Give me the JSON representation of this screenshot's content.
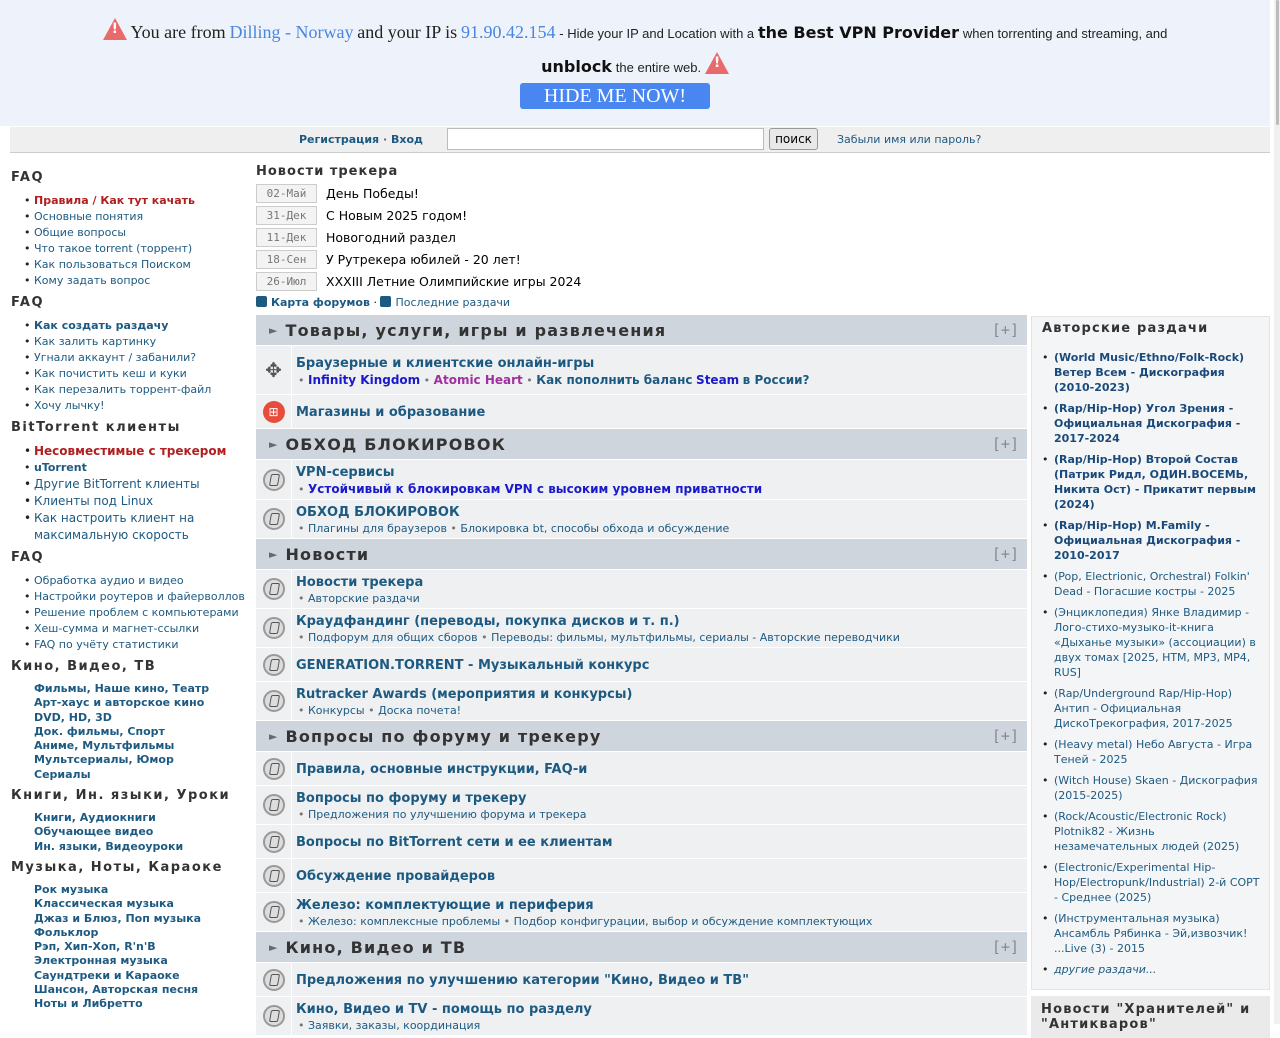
{
  "banner": {
    "p1": "You are from",
    "location": "Dilling - Norway",
    "p2": "and your IP is",
    "ip": "91.90.42.154",
    "p3": "- Hide your IP and Location with a",
    "bold1": "the Best VPN Provider",
    "p4": "when torrenting and streaming, and",
    "bold2": "unblock",
    "p5": "the entire web.",
    "button": "HIDE ME NOW!"
  },
  "nav": {
    "register": "Регистрация",
    "sep": "·",
    "login": "Вход",
    "search_value": "",
    "search_button": "поиск",
    "forgot": "Забыли имя или пароль?"
  },
  "left": [
    {
      "title": "FAQ",
      "items": [
        {
          "label": "Правила / Как тут качать",
          "style": "red"
        },
        {
          "label": "Основные понятия"
        },
        {
          "label": "Общие вопросы"
        },
        {
          "label": "Что такое torrent (торрент)"
        },
        {
          "label": "Как пользоваться Поиском"
        },
        {
          "label": "Кому задать вопрос"
        }
      ]
    },
    {
      "title": "FAQ",
      "items": [
        {
          "label": "Как создать раздачу",
          "style": "b"
        },
        {
          "label": "Как залить картинку"
        },
        {
          "label": "Угнали аккаунт / забанили?"
        },
        {
          "label": "Как почистить кеш и куки"
        },
        {
          "label": "Как перезалить торрент-файл"
        },
        {
          "label": "Хочу лычку!"
        }
      ]
    },
    {
      "title": "BitTorrent клиенты",
      "items": [
        {
          "label": "Несовместимые с трекером",
          "style": "red big"
        },
        {
          "label": "uTorrent",
          "style": "b"
        },
        {
          "label": "Другие BitTorrent клиенты",
          "style": "big"
        },
        {
          "label": "Клиенты под Linux",
          "style": "big"
        },
        {
          "label": "Как настроить клиент на максимальную скорость",
          "style": "big"
        }
      ]
    },
    {
      "title": "FAQ",
      "items": [
        {
          "label": "Обработка аудио и видео"
        },
        {
          "label": "Настройки роутеров и файерволлов"
        },
        {
          "label": "Решение проблем с компьютерами"
        },
        {
          "label": "Хеш-сумма и магнет-ссылки"
        },
        {
          "label": "FAQ по учёту статистики"
        }
      ]
    },
    {
      "title": "Кино, Видео, ТВ",
      "plain": true,
      "items": [
        {
          "label": "Фильмы, Наше кино, Театр"
        },
        {
          "label": "Арт-хаус и авторское кино"
        },
        {
          "label": "DVD, HD, 3D"
        },
        {
          "label": "Док. фильмы, Спорт"
        },
        {
          "label": "Аниме, Мультфильмы"
        },
        {
          "label": "Мультсериалы, Юмор"
        },
        {
          "label": "Сериалы"
        }
      ]
    },
    {
      "title": "Книги, Ин. языки, Уроки",
      "plain": true,
      "items": [
        {
          "label": "Книги, Аудиокниги"
        },
        {
          "label": "Обучающее видео"
        },
        {
          "label": "Ин. языки, Видеоуроки"
        }
      ]
    },
    {
      "title": "Музыка, Ноты, Караоке",
      "plain": true,
      "items": [
        {
          "label": "Рок музыка"
        },
        {
          "label": "Классическая музыка"
        },
        {
          "label": "Джаз и Блюз, Поп музыка"
        },
        {
          "label": "Фольклор"
        },
        {
          "label": "Рэп, Хип-Хоп, R'n'B"
        },
        {
          "label": "Электронная музыка"
        },
        {
          "label": "Саундтреки и Караоке"
        },
        {
          "label": "Шансон, Авторская песня"
        },
        {
          "label": "Ноты и Либретто"
        }
      ]
    }
  ],
  "news": {
    "title": "Новости трекера",
    "items": [
      {
        "date": "02-Май",
        "text": "День Победы!"
      },
      {
        "date": "31-Дек",
        "text": "С Новым 2025 годом!"
      },
      {
        "date": "11-Дек",
        "text": "Новогодний раздел"
      },
      {
        "date": "18-Сен",
        "text": "У Рутрекера юбилей - 20 лет!"
      },
      {
        "date": "26-Июл",
        "text": "XXXIII Летние Олимпийские игры 2024"
      }
    ]
  },
  "links": {
    "map": "Карта форумов",
    "dot": "·",
    "latest": "Последние раздачи"
  },
  "colors": {
    "sub_blue": "#1a1acc",
    "sub_purple": "#a030a0"
  },
  "sections": [
    {
      "title": "Товары, услуги, игры и развлечения",
      "toggle": "[+]",
      "forums": [
        {
          "icon": "gamepad",
          "title": "Браузерные и клиентские онлайн-игры",
          "subs": [
            {
              "t": "Infinity Kingdom",
              "c": "#1a1acc"
            },
            {
              "t": "Atomic Heart",
              "c": "#a030a0"
            },
            {
              "t": "Как пополнить баланс",
              "c": "#1d5a82",
              "extra": "Steam",
              "extra2": "в России?"
            }
          ]
        },
        {
          "icon": "cart",
          "title": "Магазины и образование",
          "subs": []
        }
      ]
    },
    {
      "title": "ОБХОД БЛОКИРОВОК",
      "toggle": "[+]",
      "forums": [
        {
          "title": "VPN-сервисы",
          "subs": [
            {
              "t": "Устойчивый к блокировкам VPN с высоким уровнем приватности",
              "c": "#1a1acc",
              "bold": true
            }
          ]
        },
        {
          "title": "ОБХОД БЛОКИРОВОК",
          "subs": [
            {
              "t": "Плагины для браузеров"
            },
            {
              "t": "Блокировка bt, способы обхода и обсуждение"
            }
          ]
        }
      ]
    },
    {
      "title": "Новости",
      "toggle": "[+]",
      "forums": [
        {
          "title": "Новости трекера",
          "subs": [
            {
              "t": "Авторские раздачи"
            }
          ]
        },
        {
          "title": "Краудфандинг (переводы, покупка дисков и т. п.)",
          "subs": [
            {
              "t": "Подфорум для общих сборов"
            },
            {
              "t": "Переводы: фильмы, мультфильмы, сериалы - Авторские переводчики"
            }
          ]
        },
        {
          "title": "GENERATION.TORRENT - Музыкальный конкурс",
          "subs": []
        },
        {
          "title": "Rutracker Awards (мероприятия и конкурсы)",
          "subs": [
            {
              "t": "Конкурсы"
            },
            {
              "t": "Доска почета!"
            }
          ]
        }
      ]
    },
    {
      "title": "Вопросы по форуму и трекеру",
      "toggle": "[+]",
      "forums": [
        {
          "title": "Правила, основные инструкции, FAQ-и",
          "subs": []
        },
        {
          "title": "Вопросы по форуму и трекеру",
          "subs": [
            {
              "t": "Предложения по улучшению форума и трекера"
            }
          ]
        },
        {
          "title": "Вопросы по BitTorrent сети и ее клиентам",
          "subs": []
        },
        {
          "title": "Обсуждение провайдеров",
          "subs": []
        },
        {
          "title": "Железо: комплектующие и периферия",
          "subs": [
            {
              "t": "Железо: комплексные проблемы"
            },
            {
              "t": "Подбор конфигурации, выбор и обсуждение комплектующих"
            }
          ]
        }
      ]
    },
    {
      "title": "Кино, Видео и ТВ",
      "toggle": "[+]",
      "forums": [
        {
          "title": "Предложения по улучшению категории \"Кино, Видео и ТВ\"",
          "subs": []
        },
        {
          "title": "Кино, Видео и TV - помощь по разделу",
          "subs": [
            {
              "t": "Заявки, заказы, координация"
            }
          ]
        }
      ]
    }
  ],
  "right": {
    "title": "Авторские раздачи",
    "items": [
      {
        "t": "(World Music/Ethno/Folk-Rock) Ветер Всем - Дискография (2010-2023)",
        "b": true
      },
      {
        "t": "(Rap/Hip-Hop) Угол Зрения - Официальная Дискография - 2017-2024",
        "b": true
      },
      {
        "t": "(Rap/Hip-Hop) Второй Состав (Патрик Ридл, ОДИН.ВОСЕМЬ, Никита Ост) - Прикатит первым (2024)",
        "b": true
      },
      {
        "t": "(Rap/Hip-Hop) M.Family - Официальная Дискография - 2010-2017",
        "b": true
      },
      {
        "t": "(Pop, Electrionic, Orchestral) Folkin' Dead - Погасшие костры - 2025"
      },
      {
        "t": "(Энциклопедия) Янке Владимир - Лого-стихо-музыко-it-книга «Дыханье музыки» (ассоциации) в двух томах [2025, HTM, MP3, MP4, RUS]"
      },
      {
        "t": "(Rap/Underground Rap/Hip-Hop) Антип - Официальная ДискоТрекография, 2017-2025"
      },
      {
        "t": "(Heavy metal) Небо Августа - Игра Теней - 2025"
      },
      {
        "t": "(Witch House) Skaen - Дискография (2015-2025)"
      },
      {
        "t": "(Rock/Acoustic/Electronic Rock) Plotnik82 - Жизнь незамечательных людей (2025)"
      },
      {
        "t": "(Electronic/Experimental Hip-Hop/Electropunk/Industrial) 2-й СОРТ - Среднее (2025)"
      },
      {
        "t": "(Инструментальная музыка) Ансамбль Рябинка - Эй,извозчик! ...Live (3) - 2015"
      },
      {
        "t": "другие раздачи...",
        "more": true
      }
    ],
    "box2_title": "Новости \"Хранителей\" и \"Антикваров\""
  }
}
